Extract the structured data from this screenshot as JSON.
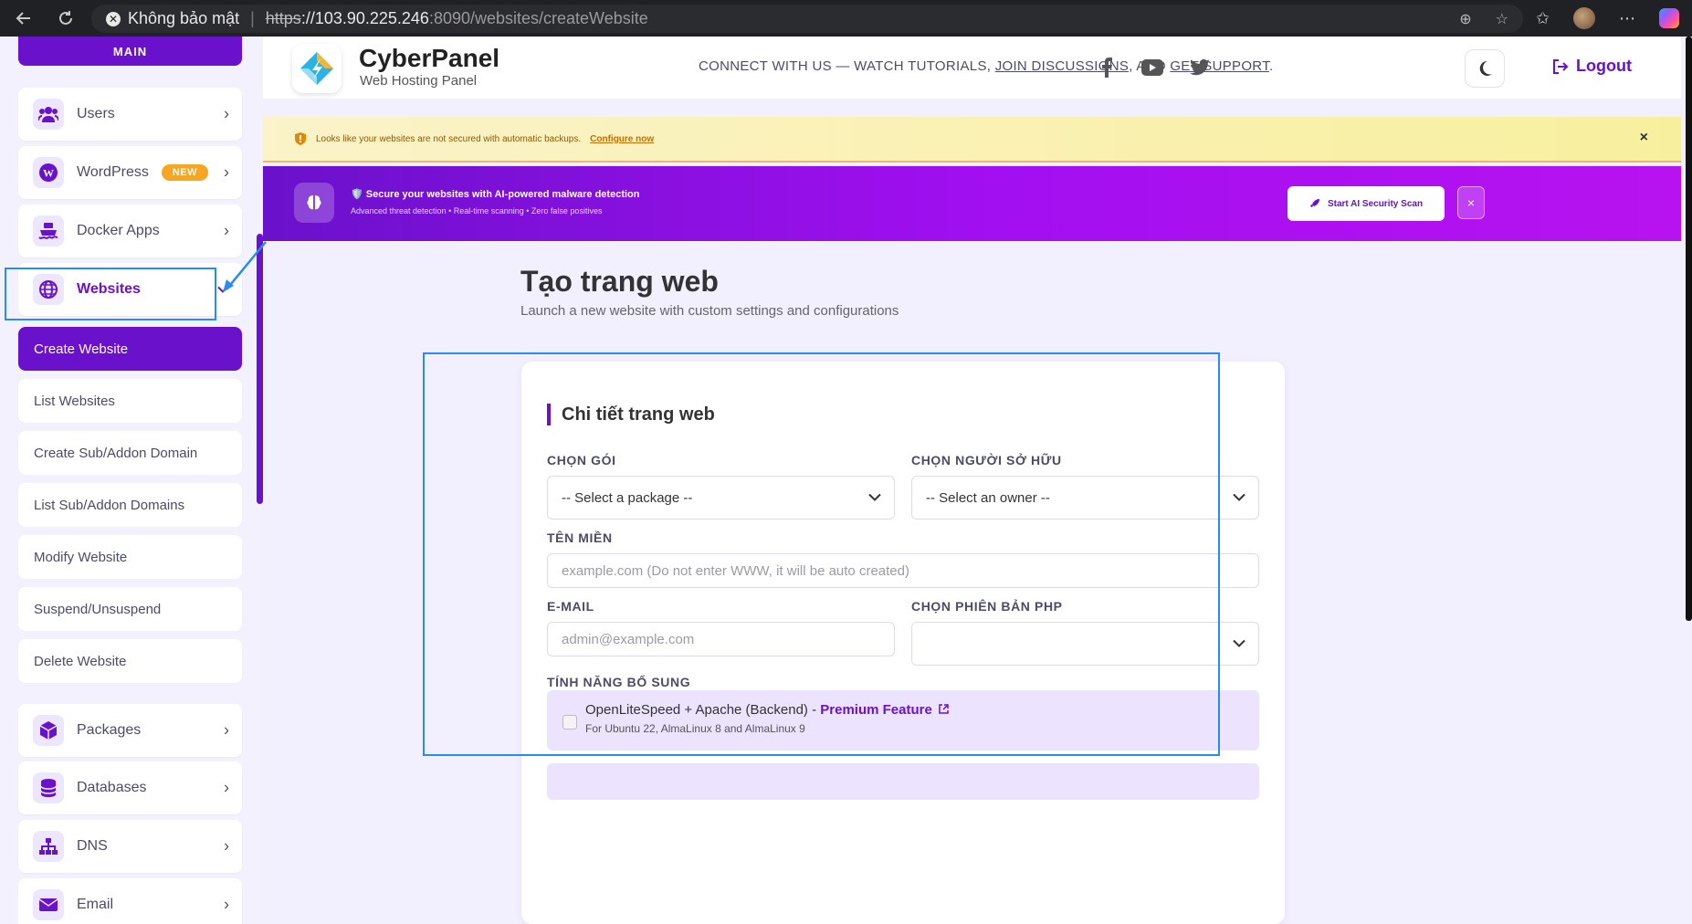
{
  "browser": {
    "security_label": "Không bảo mật",
    "url_scheme": "https",
    "url_host": "://103.90.225.246",
    "url_path": ":8090/websites/createWebsite"
  },
  "sidebar": {
    "section_label": "MAIN",
    "items": [
      {
        "label": "Users",
        "icon": "users-icon"
      },
      {
        "label": "WordPress",
        "icon": "wordpress-icon",
        "badge": "NEW"
      },
      {
        "label": "Docker Apps",
        "icon": "docker-icon"
      },
      {
        "label": "Websites",
        "icon": "globe-icon"
      },
      {
        "label": "Packages",
        "icon": "package-icon"
      },
      {
        "label": "Databases",
        "icon": "database-icon"
      },
      {
        "label": "DNS",
        "icon": "network-icon"
      },
      {
        "label": "Email",
        "icon": "mail-icon"
      }
    ],
    "website_subitems": [
      "Create Website",
      "List Websites",
      "Create Sub/Addon Domain",
      "List Sub/Addon Domains",
      "Modify Website",
      "Suspend/Unsuspend",
      "Delete Website"
    ]
  },
  "header": {
    "brand_name": "CyberPanel",
    "brand_sub": "Web Hosting Panel",
    "connect_prefix": "CONNECT WITH US — WATCH TUTORIALS, ",
    "connect_link1": "JOIN DISCUSSIONS",
    "connect_mid": ", AND ",
    "connect_link2": "GET SUPPORT",
    "connect_suffix": ".",
    "logout_label": "Logout"
  },
  "warning": {
    "text": "Looks like your websites are not secured with automatic backups.",
    "link": "Configure now",
    "close": "×"
  },
  "promo": {
    "title": "🛡️ Secure your websites with AI-powered malware detection",
    "subtitle": "Advanced threat detection • Real-time scanning • Zero false positives",
    "button": "Start AI Security Scan",
    "close": "×"
  },
  "page": {
    "title": "Tạo trang web",
    "subtitle": "Launch a new website with custom settings and configurations"
  },
  "form": {
    "card_title": "Chi tiết trang web",
    "package_label": "CHỌN GÓI",
    "package_value": "-- Select a package --",
    "owner_label": "CHỌN NGƯỜI SỞ HỮU",
    "owner_value": "-- Select an owner --",
    "domain_label": "TÊN MIỀN",
    "domain_placeholder": "example.com (Do not enter WWW, it will be auto created)",
    "email_label": "E-MAIL",
    "email_placeholder": "admin@example.com",
    "php_label": "CHỌN PHIÊN BẢN PHP",
    "php_value": "",
    "extras_label": "TÍNH NĂNG BỔ SUNG",
    "feature_name": "OpenLiteSpeed + Apache (Backend) - ",
    "feature_premium": "Premium Feature",
    "feature_note": "For Ubuntu 22, AlmaLinux 8 and AlmaLinux 9"
  },
  "colors": {
    "accent": "#6a11cb",
    "annotation": "#2a8cf0",
    "badge": "#f5a623"
  }
}
